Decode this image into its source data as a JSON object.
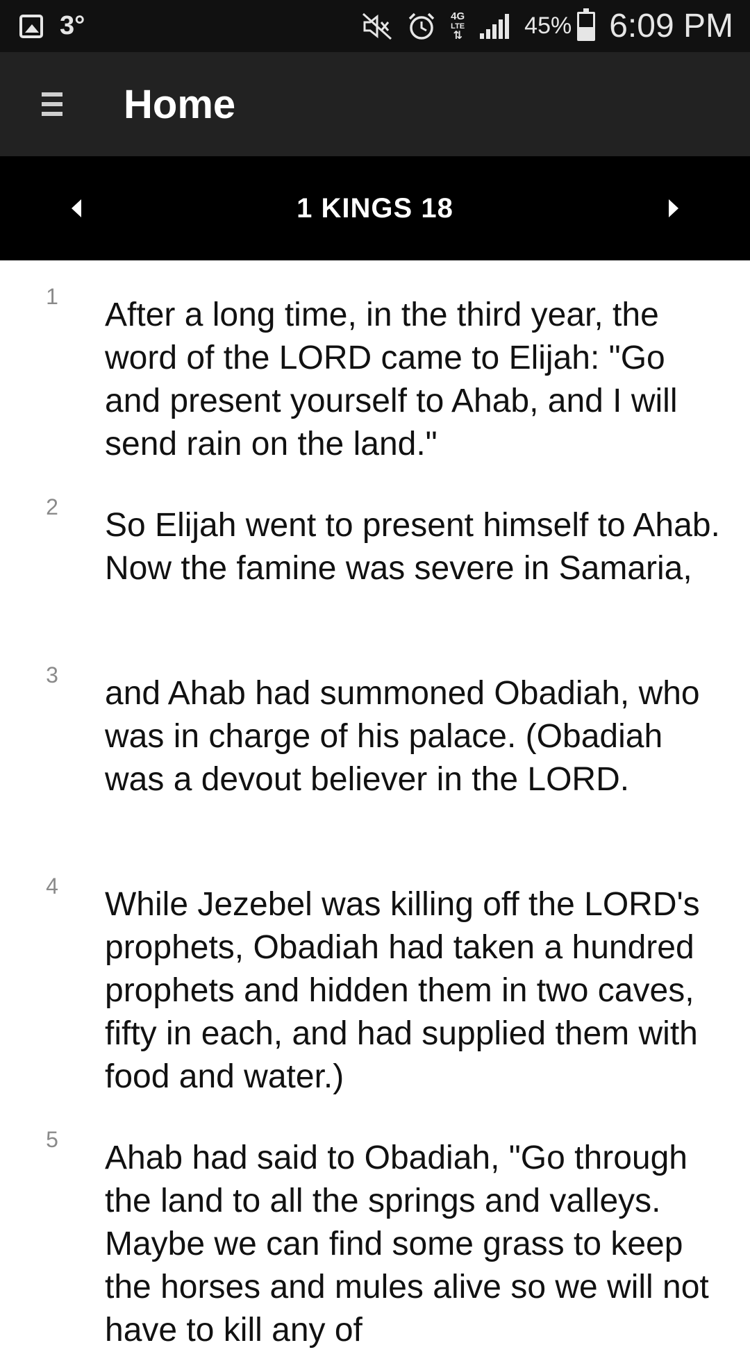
{
  "status_bar": {
    "left_icon": "image-icon",
    "temperature": "3°",
    "icons": [
      "mute-icon",
      "alarm-icon",
      "lte-icon",
      "signal-icon"
    ],
    "lte_top": "4G",
    "lte_bottom": "LTE",
    "battery_percent": "45%",
    "battery_level": 0.45,
    "time": "6:09 PM"
  },
  "app_bar": {
    "title": "Home",
    "menu_icon": "hamburger-menu-icon"
  },
  "chapter_nav": {
    "title": "1 KINGS 18",
    "prev_icon": "arrow-left-icon",
    "next_icon": "arrow-right-icon"
  },
  "verses": [
    {
      "number": "1",
      "text": "After a long time, in the third year, the word of the LORD came to Elijah: \"Go and present yourself to Ahab, and I will send rain on the land.\""
    },
    {
      "number": "2",
      "text": "So Elijah went to present himself to Ahab. Now the famine was severe in Samaria,"
    },
    {
      "number": "3",
      "text": "and Ahab had summoned Obadiah, who was in charge of his palace. (Obadiah was a devout believer in the LORD."
    },
    {
      "number": "4",
      "text": "While Jezebel was killing off the LORD's prophets, Obadiah had taken a hundred prophets and hidden them in two caves, fifty in each, and had supplied them with food and water.)"
    },
    {
      "number": "5",
      "text": "Ahab had said to Obadiah, \"Go through the land to all the springs and valleys. Maybe we can find some grass to keep the horses and mules alive so we will not have to kill any of"
    }
  ]
}
